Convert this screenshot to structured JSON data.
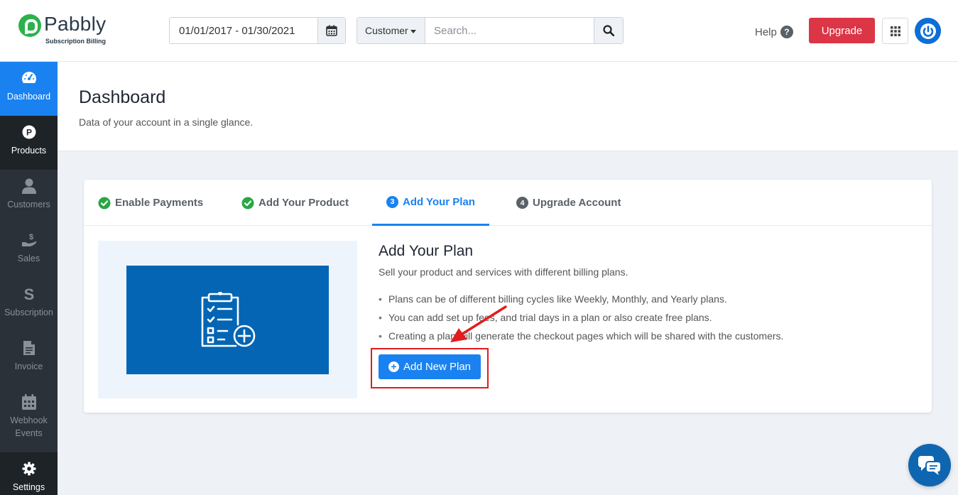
{
  "brand": {
    "name": "Pabbly",
    "tagline": "Subscription Billing",
    "accent": "#1a82f0",
    "logo_green": "#2bb24c"
  },
  "header": {
    "date_range": "01/01/2017 - 01/30/2021",
    "search_scope": "Customer",
    "search_placeholder": "Search...",
    "help_label": "Help",
    "upgrade_label": "Upgrade"
  },
  "sidebar": {
    "items": [
      {
        "label": "Dashboard",
        "icon": "dashboard-icon"
      },
      {
        "label": "Products",
        "icon": "products-icon"
      },
      {
        "label": "Customers",
        "icon": "customers-icon"
      },
      {
        "label": "Sales",
        "icon": "sales-icon"
      },
      {
        "label": "Subscription",
        "icon": "subscription-icon"
      },
      {
        "label": "Invoice",
        "icon": "invoice-icon"
      },
      {
        "label": "Webhook Events",
        "icon": "calendar-icon"
      },
      {
        "label": "Settings",
        "icon": "gear-icon"
      }
    ]
  },
  "page": {
    "title": "Dashboard",
    "subtitle": "Data of your account in a single glance."
  },
  "steps": {
    "tabs": [
      {
        "label": "Enable Payments",
        "state": "done"
      },
      {
        "label": "Add Your Product",
        "state": "done"
      },
      {
        "label": "Add Your Plan",
        "state": "active",
        "number": "3"
      },
      {
        "label": "Upgrade Account",
        "state": "pending",
        "number": "4"
      }
    ],
    "panel": {
      "title": "Add Your Plan",
      "subtitle": "Sell your product and services with different billing plans.",
      "bullets": [
        "Plans can be of different billing cycles like Weekly, Monthly, and Yearly plans.",
        "You can add set up fees, and trial days in a plan or also create free plans.",
        "Creating a plan will generate the checkout pages which will be shared with the customers."
      ],
      "button_label": "Add New Plan"
    }
  }
}
